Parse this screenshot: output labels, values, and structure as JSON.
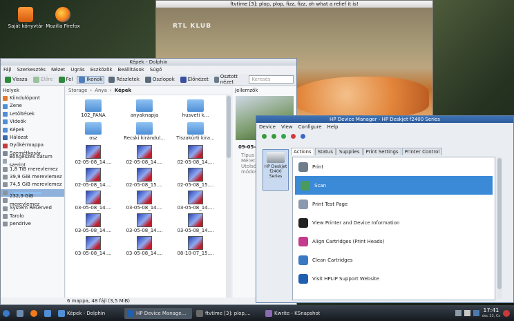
{
  "desktop": {
    "icons": [
      {
        "label": "Saját könyvtár",
        "icon": "home-folder-icon"
      },
      {
        "label": "Mozilla Firefox",
        "icon": "firefox-icon"
      }
    ]
  },
  "video_window": {
    "title": "ftvtime [3]: plop, plop, fizz, fizz, oh what a relief it is!",
    "channel_logo": "RTL KLUB"
  },
  "dolphin": {
    "title": "Képek - Dolphin",
    "menu": [
      "Fájl",
      "Szerkesztés",
      "Nézet",
      "Ugrás",
      "Eszközök",
      "Beállítások",
      "Súgó"
    ],
    "toolbar": [
      {
        "label": "Vissza",
        "icon": "back-arrow-icon"
      },
      {
        "label": "Előre",
        "icon": "forward-arrow-icon"
      },
      {
        "label": "Fel",
        "icon": "up-arrow-icon"
      },
      {
        "label": "Ikonok",
        "icon": "icons-view-icon"
      },
      {
        "label": "Részletek",
        "icon": "details-view-icon"
      },
      {
        "label": "Oszlopok",
        "icon": "columns-view-icon"
      },
      {
        "label": "Előnézet",
        "icon": "preview-icon"
      },
      {
        "label": "Osztott nézet",
        "icon": "split-view-icon"
      }
    ],
    "search_placeholder": "Keresés",
    "places_header": "Helyek",
    "places": [
      {
        "label": "Kiindulópont",
        "icon": "home-icon"
      },
      {
        "label": "Zene",
        "icon": "music-icon"
      },
      {
        "label": "Letöltések",
        "icon": "download-icon"
      },
      {
        "label": "Videók",
        "icon": "video-icon"
      },
      {
        "label": "Képek",
        "icon": "pictures-icon"
      },
      {
        "label": "Hálózat",
        "icon": "network-icon"
      },
      {
        "label": "Gyökérmappa",
        "icon": "root-folder-icon"
      },
      {
        "label": "Szemétkosár",
        "icon": "trash-icon"
      },
      {
        "label": "Böngészés dátum szerint",
        "icon": "calendar-icon"
      },
      {
        "label": "1,8 TiB merevlemez",
        "icon": "harddisk-icon"
      },
      {
        "label": "39,9 GiB merevlemez",
        "icon": "harddisk-icon"
      },
      {
        "label": "74,5 GiB merevlemez",
        "icon": "harddisk-icon"
      },
      {
        "label": "",
        "icon": "harddisk-icon"
      },
      {
        "label": "232,9 GiB merevlemez",
        "icon": "harddisk-icon"
      },
      {
        "label": "System Reserved",
        "icon": "harddisk-icon"
      },
      {
        "label": "Tarolo",
        "icon": "harddisk-icon"
      },
      {
        "label": "pendrive",
        "icon": "usb-drive-icon"
      }
    ],
    "breadcrumb": [
      "Storage",
      "Anya",
      "Képek"
    ],
    "files": [
      {
        "name": "102_PANA",
        "type": "folder"
      },
      {
        "name": "anyaknapja",
        "type": "folder"
      },
      {
        "name": "husveti k...",
        "type": "folder"
      },
      {
        "name": "osz",
        "type": "folder"
      },
      {
        "name": "Recski kirándul...",
        "type": "folder"
      },
      {
        "name": "Tiszakürti kira...",
        "type": "folder"
      },
      {
        "name": "02-05-08_14....",
        "type": "image"
      },
      {
        "name": "02-05-08_14....",
        "type": "image"
      },
      {
        "name": "02-05-08_14....",
        "type": "image"
      },
      {
        "name": "02-05-08_14....",
        "type": "image"
      },
      {
        "name": "02-05-08_15....",
        "type": "image"
      },
      {
        "name": "02-05-08_15....",
        "type": "image"
      },
      {
        "name": "03-05-08_14....",
        "type": "image"
      },
      {
        "name": "03-05-08_14....",
        "type": "image"
      },
      {
        "name": "03-05-08_14....",
        "type": "image"
      },
      {
        "name": "03-05-08_14....",
        "type": "image"
      },
      {
        "name": "03-05-08_14....",
        "type": "image"
      },
      {
        "name": "03-05-08_14....",
        "type": "image"
      },
      {
        "name": "03-05-08_14....",
        "type": "image"
      },
      {
        "name": "03-05-08_14....",
        "type": "image"
      },
      {
        "name": "08-10-07_15....",
        "type": "image"
      }
    ],
    "info_panel": {
      "header": "Jellemzők",
      "date": "09-05-0",
      "lines": [
        "Típus",
        "Méret",
        "Utolsó",
        "módosítás"
      ]
    },
    "status": "6 mappa, 48 fájl (3,5 MiB)"
  },
  "hp": {
    "title": "HP Device Manager - HP Deskjet f2400 Series",
    "menu": [
      "Device",
      "View",
      "Configure",
      "Help"
    ],
    "device_label": "HP Deskjet f2400 Series",
    "tabs": [
      "Actions",
      "Status",
      "Supplies",
      "Print Settings",
      "Printer Control"
    ],
    "active_tab": "Actions",
    "actions": [
      {
        "label": "Print",
        "icon": "printer-icon",
        "color": "#6f7c8a"
      },
      {
        "label": "Scan",
        "icon": "scanner-icon",
        "color": "#4a9a5f"
      },
      {
        "label": "Print Test Page",
        "icon": "test-page-icon",
        "color": "#8a99ad"
      },
      {
        "label": "View Printer and Device Information",
        "icon": "info-icon",
        "color": "#222222"
      },
      {
        "label": "Align Cartridges (Print Heads)",
        "icon": "cartridge-icon",
        "color": "#c43a8c"
      },
      {
        "label": "Clean Cartridges",
        "icon": "clean-icon",
        "color": "#3a78c4"
      },
      {
        "label": "Visit HPLIP Support Website",
        "icon": "hp-logo-icon",
        "color": "#1f5fb0"
      }
    ],
    "selected_action": "Scan"
  },
  "taskbar": {
    "items": [
      {
        "label": "Képek - Dolphin",
        "icon": "dolphin-icon",
        "active": false
      },
      {
        "label": "HP Device Manage...",
        "icon": "hp-icon",
        "active": true
      },
      {
        "label": "ftvtime [3]: plop,...",
        "icon": "tv-icon",
        "active": false
      },
      {
        "label": "Kwrite - KSnapshot",
        "icon": "snapshot-icon",
        "active": false
      }
    ],
    "clock": {
      "time": "17:41",
      "date": "dec 23, Cs"
    }
  },
  "colors": {
    "accent": "#3a8ad8",
    "selection": "#8fb2dc",
    "taskbar": "#1f242a"
  }
}
